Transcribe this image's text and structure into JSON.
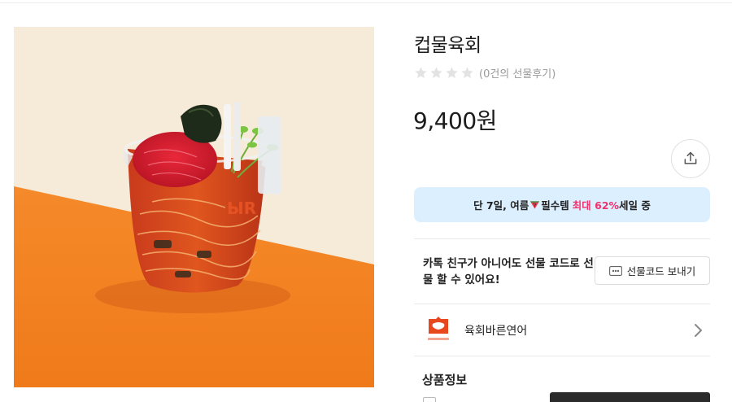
{
  "product": {
    "title": "컵물육회",
    "rating_stars": 0,
    "rating_max": 5,
    "review_count_text": "(0건의 선물후기)",
    "price": "9,400원"
  },
  "promo": {
    "text_before": "단 7일, 여름",
    "text_middle": "필수템",
    "highlight": "최대 62%",
    "text_after": "세일 중"
  },
  "gift": {
    "description": "카톡 친구가 아니어도 선물 코드로 선물 할 수 있어요!",
    "button_label": "선물코드 보내기"
  },
  "brand": {
    "name": "육회바른연어",
    "logo_caption": "육회바른연어"
  },
  "sections": {
    "product_info": "상품정보"
  },
  "colors": {
    "promo_bg": "#dcefff",
    "promo_highlight": "#f0326e",
    "brand_logo": "#e8481e"
  }
}
